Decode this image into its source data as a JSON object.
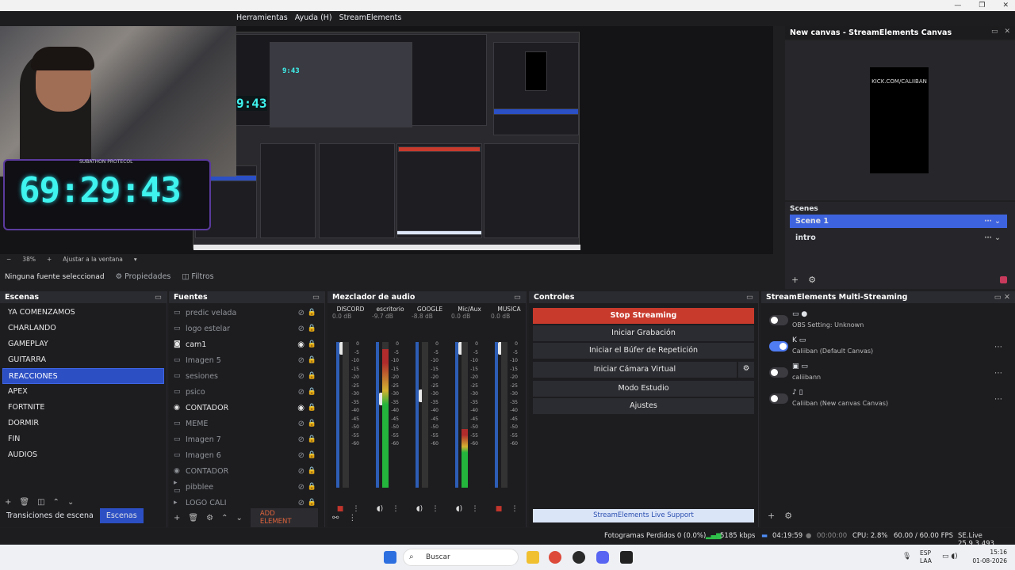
{
  "window": {
    "menus": [
      "Herramientas",
      "Ayuda (H)",
      "StreamElements"
    ],
    "controls": [
      "—",
      "❐",
      "✕"
    ]
  },
  "preview": {
    "timer_label": "SUBATHON PROTECOL",
    "timer": "69:29:43",
    "nested_timer": "9:43",
    "nested_timer_small": "9:43",
    "zoom": "38%",
    "fit_label": "Ajustar a la ventana"
  },
  "canvas": {
    "title": "New canvas - StreamElements Canvas",
    "preview_text": "KICK.COM/CALIIBAN",
    "scenes_label": "Scenes",
    "scenes": [
      "Scene 1",
      "intro"
    ]
  },
  "properties_bar": {
    "no_source": "Ninguna fuente seleccionad",
    "properties": "Propiedades",
    "filters": "Filtros"
  },
  "escenas": {
    "title": "Escenas",
    "items": [
      "YA COMENZAMOS",
      "CHARLANDO",
      "GAMEPLAY",
      "GUITARRA",
      "REACCIONES",
      "APEX",
      "FORTNITE",
      "DORMIR",
      "FIN",
      "AUDIOS"
    ],
    "selected": "REACCIONES",
    "tab_transitions": "Transiciones de escena",
    "tab_scenes": "Escenas"
  },
  "fuentes": {
    "title": "Fuentes",
    "items": [
      {
        "name": "predic velada",
        "icon": "▭",
        "visible": false
      },
      {
        "name": "logo estelar",
        "icon": "▭",
        "visible": false
      },
      {
        "name": "cam1",
        "icon": "◙",
        "visible": true
      },
      {
        "name": "Imagen 5",
        "icon": "▭",
        "visible": false
      },
      {
        "name": "sesiones",
        "icon": "▭",
        "visible": false
      },
      {
        "name": "psico",
        "icon": "▭",
        "visible": false
      },
      {
        "name": "CONTADOR",
        "icon": "◉",
        "visible": true
      },
      {
        "name": "MEME",
        "icon": "▭",
        "visible": false
      },
      {
        "name": "Imagen 7",
        "icon": "▭",
        "visible": false
      },
      {
        "name": "Imagen 6",
        "icon": "▭",
        "visible": false
      },
      {
        "name": "CONTADOR",
        "icon": "◉",
        "visible": false
      },
      {
        "name": "pibblee",
        "icon": "▸ ▭",
        "visible": false
      },
      {
        "name": "LOGO CALI",
        "icon": "▸",
        "visible": false
      }
    ],
    "add_element": "ADD ELEMENT"
  },
  "mixer": {
    "title": "Mezclador de audio",
    "scale": [
      "0",
      "-5",
      "-10",
      "-15",
      "-20",
      "-25",
      "-30",
      "-35",
      "-40",
      "-45",
      "-50",
      "-55",
      "-60"
    ],
    "channels": [
      {
        "name": "DISCORD",
        "db": "0.0 dB",
        "level": 0.0,
        "fader": 1.0,
        "muted": true
      },
      {
        "name": "escritorio",
        "db": "-9.7 dB",
        "level": 0.95,
        "fader": 0.62,
        "muted": false
      },
      {
        "name": "GOOGLE",
        "db": "-8.8 dB",
        "level": 0.0,
        "fader": 0.64,
        "muted": false
      },
      {
        "name": "Mic/Aux",
        "db": "0.0 dB",
        "level": 0.4,
        "fader": 1.0,
        "muted": false
      },
      {
        "name": "MUSICA",
        "db": "0.0 dB",
        "level": 0.0,
        "fader": 1.0,
        "muted": true
      }
    ]
  },
  "controles": {
    "title": "Controles",
    "buttons": [
      "Stop Streaming",
      "Iniciar Grabación",
      "Iniciar el Búfer de Repetición",
      "Iniciar Cámara Virtual",
      "Modo Estudio",
      "Ajustes"
    ],
    "support": "StreamElements Live Support"
  },
  "multistream": {
    "title": "StreamElements Multi-Streaming",
    "rows": [
      {
        "name": "OBS Setting: Unknown",
        "on": false,
        "icons": "▭ ●"
      },
      {
        "name": "Caliiban (Default Canvas)",
        "on": true,
        "icons": "K ▭"
      },
      {
        "name": "caliibann",
        "on": false,
        "icons": "▣ ▭"
      },
      {
        "name": "Caliiban (New canvas Canvas)",
        "on": false,
        "icons": "♪ ▯"
      }
    ]
  },
  "status": {
    "dropped": "Fotogramas Perdidos 0 (0.0%)",
    "kbps": "5185 kbps",
    "live_time": "04:19:59",
    "rec_time": "00:00:00",
    "cpu": "CPU: 2.8%",
    "fps": "60.00 / 60.00 FPS",
    "version": "SE.Live 25.9.3.493"
  },
  "taskbar": {
    "search": "Buscar",
    "lang": "ESP",
    "lang2": "LAA",
    "time": "15:16",
    "date": "01-08-2026"
  }
}
